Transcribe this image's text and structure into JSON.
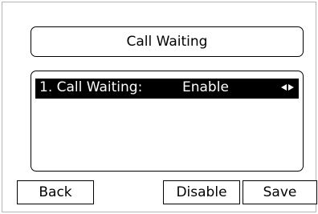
{
  "header": {
    "title": "Call Waiting"
  },
  "menu": {
    "items": [
      {
        "label": "1. Call Waiting:",
        "value": "Enable",
        "icon": "left-right-arrows-icon"
      }
    ]
  },
  "softkeys": {
    "back": "Back",
    "disable": "Disable",
    "save": "Save"
  },
  "colors": {
    "selection_background": "#000000",
    "selection_text": "#ffffff",
    "screen_background": "#ffffff",
    "border": "#000000"
  }
}
